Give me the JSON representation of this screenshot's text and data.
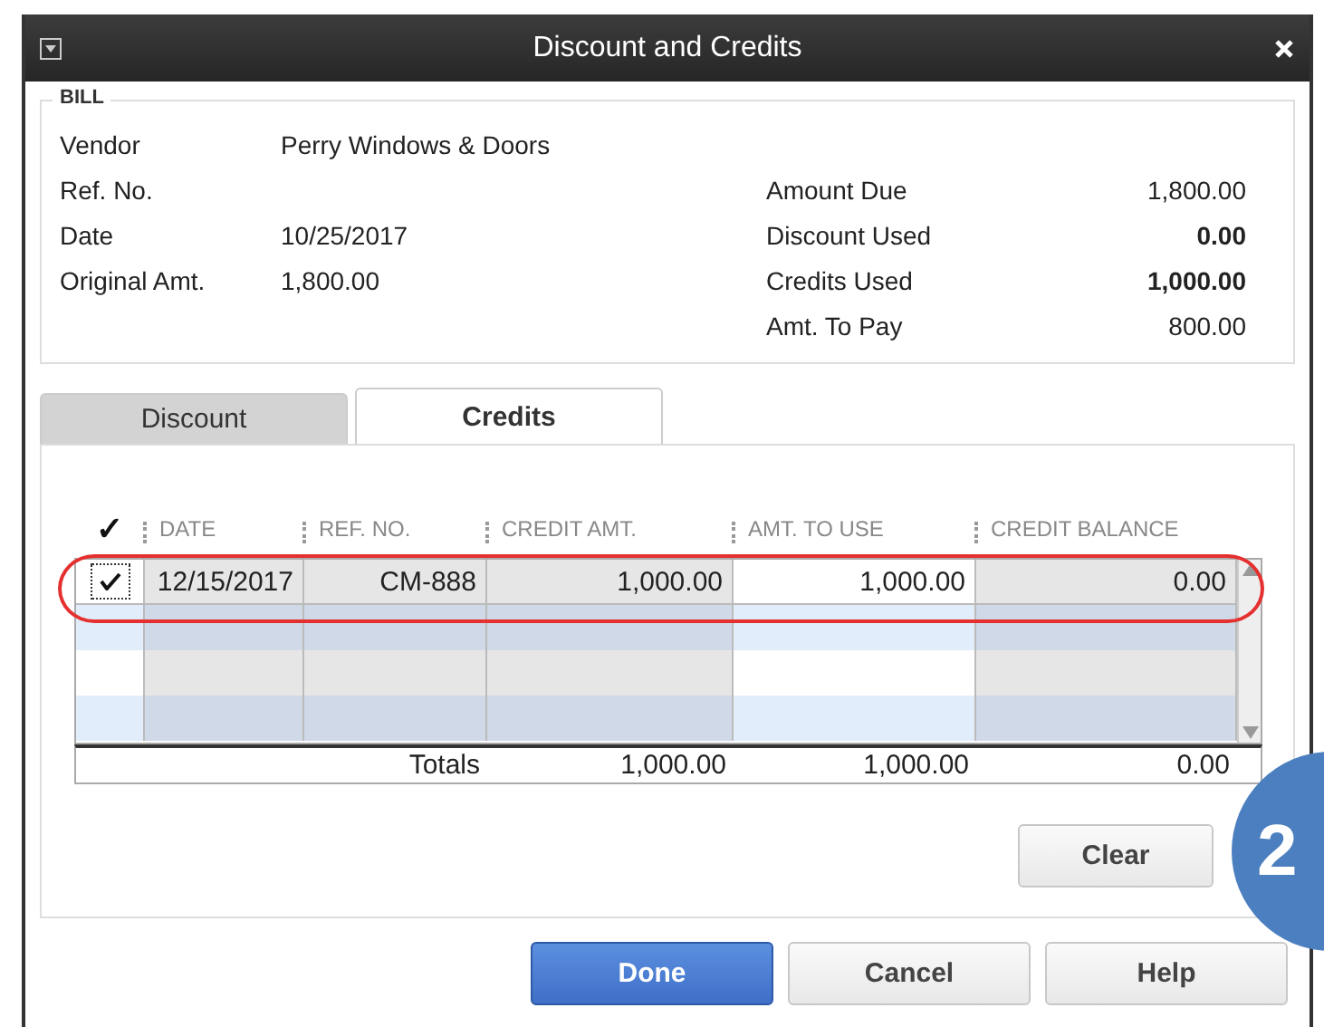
{
  "window": {
    "title": "Discount and Credits"
  },
  "bill": {
    "legend": "BILL",
    "left": [
      {
        "label": "Vendor",
        "value": "Perry Windows & Doors"
      },
      {
        "label": "Ref. No."
      },
      {
        "label": "Date",
        "value": "10/25/2017"
      },
      {
        "label": "Original Amt.",
        "value": "1,800.00"
      }
    ],
    "right": [
      {
        "label": "Amount Due",
        "value": "1,800.00",
        "bold": false
      },
      {
        "label": "Discount Used",
        "value": "0.00",
        "bold": true
      },
      {
        "label": "Credits Used",
        "value": "1,000.00",
        "bold": true
      },
      {
        "label": "Amt. To Pay",
        "value": "800.00",
        "bold": false
      }
    ]
  },
  "tabs": [
    {
      "label": "Discount",
      "selected": false
    },
    {
      "label": "Credits",
      "selected": true
    }
  ],
  "table": {
    "check_header": "✓",
    "columns": [
      "DATE",
      "REF. NO.",
      "CREDIT AMT.",
      "AMT. TO USE",
      "CREDIT BALANCE"
    ],
    "rows": [
      {
        "checked": true,
        "cells": [
          "12/15/2017",
          "CM-888",
          "1,000.00",
          "1,000.00",
          "0.00"
        ]
      }
    ],
    "totals": {
      "label": "Totals",
      "values": [
        "1,000.00",
        "1,000.00",
        "0.00"
      ]
    }
  },
  "clear_button": "Clear",
  "buttons": [
    {
      "label": "Done",
      "kind": "primary"
    },
    {
      "label": "Cancel",
      "kind": "normal"
    },
    {
      "label": "Help",
      "kind": "normal"
    }
  ],
  "callout": "2"
}
